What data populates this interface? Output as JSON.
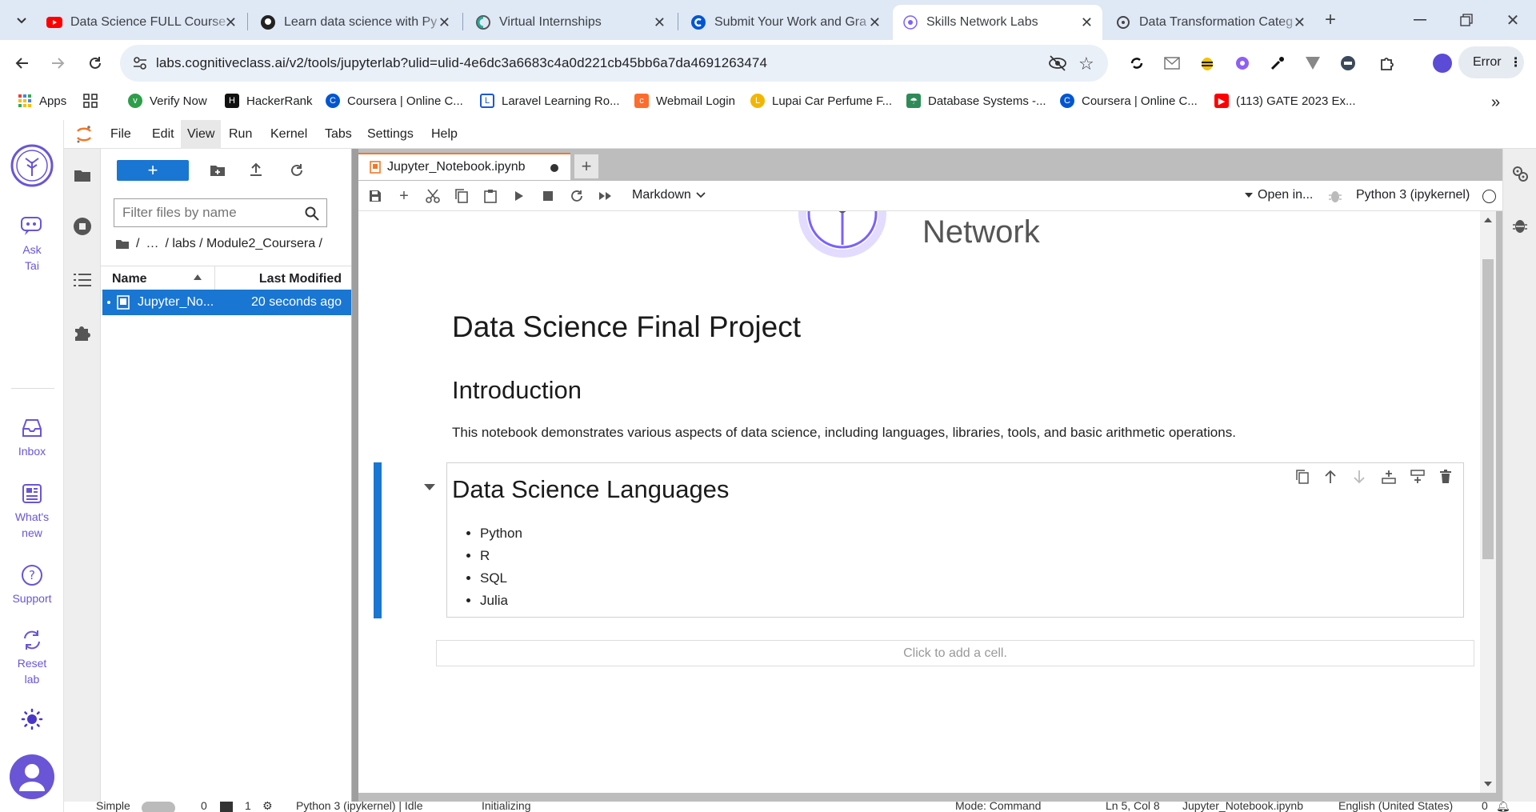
{
  "browser": {
    "tabs": [
      {
        "title": "Data Science FULL Course",
        "icon": "youtube-icon"
      },
      {
        "title": "Learn data science with Py",
        "icon": "github-icon"
      },
      {
        "title": "Virtual Internships",
        "icon": "forage-icon"
      },
      {
        "title": "Submit Your Work and Gra",
        "icon": "coursera-icon"
      },
      {
        "title": "Skills Network Labs",
        "icon": "skills-network-icon",
        "active": true
      },
      {
        "title": "Data Transformation Categ",
        "icon": "chatgpt-icon"
      }
    ],
    "url": "labs.cognitiveclass.ai/v2/tools/jupyterlab?ulid=ulid-4e6dc3a6683c4a0d221cb45bb6a7da4691263474",
    "profile_button": "Error",
    "bookmarks": [
      {
        "label": "Apps"
      },
      {
        "label": "Verify Now"
      },
      {
        "label": "HackerRank"
      },
      {
        "label": "Coursera | Online C..."
      },
      {
        "label": "Laravel Learning Ro..."
      },
      {
        "label": "Webmail Login"
      },
      {
        "label": "Lupai Car Perfume F..."
      },
      {
        "label": "Database Systems -..."
      },
      {
        "label": "Coursera | Online C..."
      },
      {
        "label": "(113) GATE 2023 Ex..."
      }
    ]
  },
  "skills_sidebar": {
    "ask_label": "Ask Tai",
    "inbox_label": "Inbox",
    "whats_new_label": "What's new",
    "support_label": "Support",
    "reset_label": "Reset lab"
  },
  "menu": [
    "File",
    "Edit",
    "View",
    "Run",
    "Kernel",
    "Tabs",
    "Settings",
    "Help"
  ],
  "filebrowser": {
    "filter_placeholder": "Filter files by name",
    "crumbs": [
      "/",
      "…",
      "/ labs / Module2_Coursera /"
    ],
    "col_name": "Name",
    "col_modified": "Last Modified",
    "file_name": "Jupyter_No...",
    "file_modified": "20 seconds ago"
  },
  "notebook": {
    "tab_title": "Jupyter_Notebook.ipynb",
    "cell_type": "Markdown",
    "open_in": "Open in...",
    "kernel": "Python 3 (ipykernel)",
    "logo_text": "Network",
    "title": "Data Science Final Project",
    "intro_heading": "Introduction",
    "intro_text": "This notebook demonstrates various aspects of data science, including languages, libraries, tools, and basic arithmetic operations.",
    "languages_heading": "Data Science Languages",
    "languages": [
      "Python",
      "R",
      "SQL",
      "Julia"
    ],
    "add_cell": "Click to add a cell."
  },
  "statusbar": {
    "simple": "Simple",
    "count_a": "0",
    "count_b": "1",
    "kernel_status": "Python 3 (ipykernel) | Idle",
    "initializing": "Initializing",
    "mode": "Mode: Command",
    "position": "Ln 5, Col 8",
    "file": "Jupyter_Notebook.ipynb",
    "language": "English (United States)",
    "notifications": "0"
  }
}
